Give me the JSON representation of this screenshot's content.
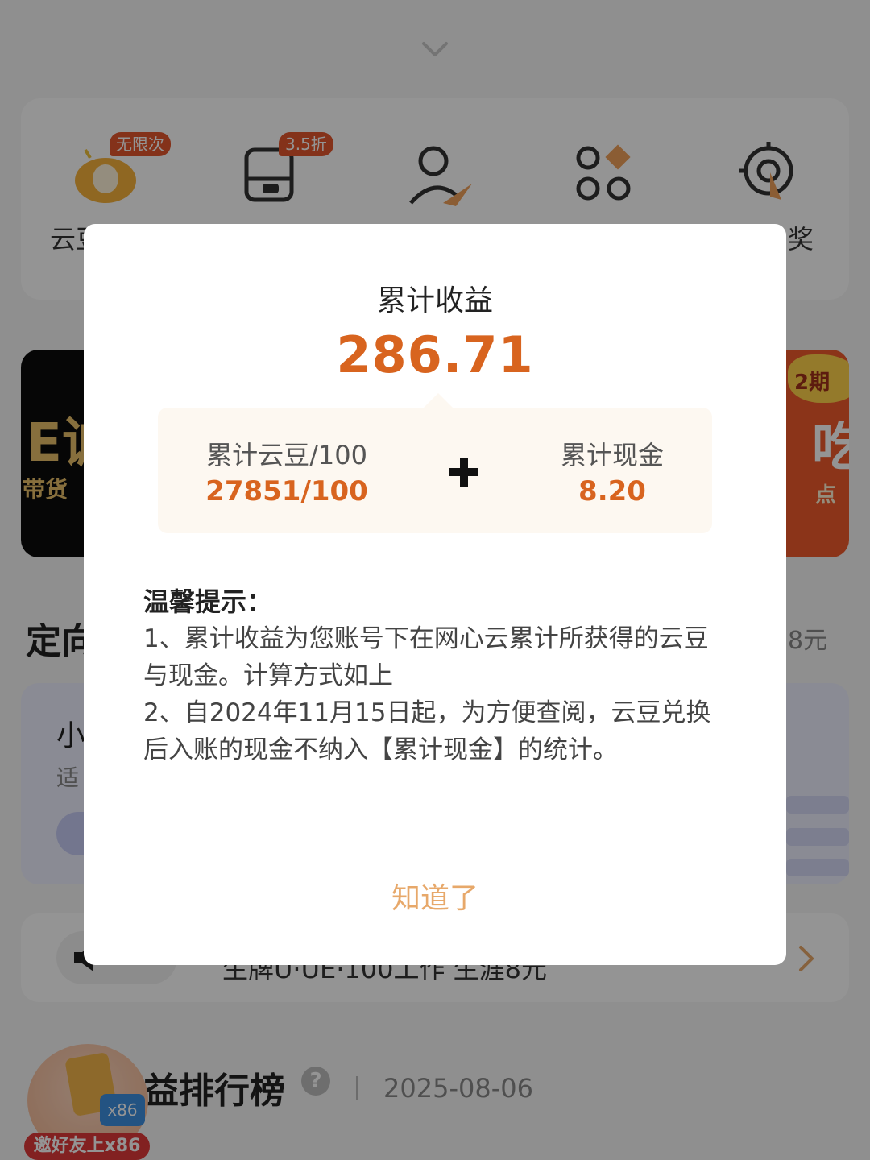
{
  "background": {
    "tools": [
      {
        "label": "云豆",
        "badge": "无限次",
        "icon": "cloud-bean-icon"
      },
      {
        "label": "",
        "badge": "3.5折",
        "icon": "storage-drive-icon"
      },
      {
        "label": "",
        "badge": "",
        "icon": "user-send-icon"
      },
      {
        "label": "",
        "badge": "",
        "icon": "apps-grid-icon"
      },
      {
        "label": "奖",
        "badge": "",
        "icon": "target-tap-icon"
      }
    ],
    "banner_left": {
      "big": "E诚",
      "small": "带货"
    },
    "banner_right": {
      "burst": "2期",
      "big": "吃",
      "small": "点"
    },
    "section_title": "定向",
    "section_right": "8元",
    "plan_card": {
      "title": "小",
      "subtitle": "适"
    },
    "notice": {
      "text": "生牌U·UE·100工作 生涯8元"
    },
    "rank": {
      "title": "益排行榜",
      "date": "2025-08-06"
    },
    "invite": {
      "badge": "x86",
      "label": "邀好友上x86"
    }
  },
  "modal": {
    "title": "累计收益",
    "total": "286.71",
    "left_label": "累计云豆/100",
    "left_value": "27851/100",
    "right_label": "累计现金",
    "right_value": "8.20",
    "tips_title": "温馨提示：",
    "tips": [
      "1、累计收益为您账号下在网心云累计所获得的云豆与现金。计算方式如上",
      "2、自2024年11月15日起，为方便查阅，云豆兑换后入账的现金不纳入【累计现金】的统计。"
    ],
    "confirm": "知道了"
  },
  "colors": {
    "accent": "#d8641f",
    "confirm": "#e7a86a",
    "card_bg": "#fdf8f1"
  }
}
